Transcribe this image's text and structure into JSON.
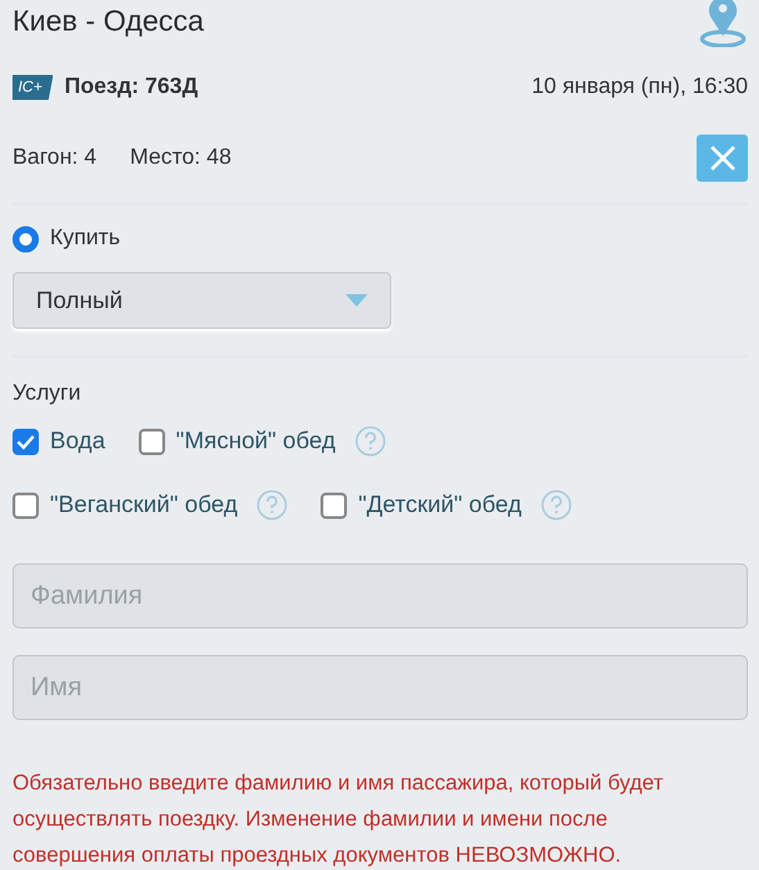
{
  "route": {
    "title": "Киев - Одесса"
  },
  "train": {
    "logo": "IC+",
    "label": "Поезд: 763Д",
    "datetime": "10 января (пн), 16:30"
  },
  "seat": {
    "wagon": "Вагон: 4",
    "place": "Место: 48"
  },
  "ticket_type": {
    "label": "Купить",
    "selected": true
  },
  "fare": {
    "value": "Полный"
  },
  "services": {
    "title": "Услуги",
    "items": [
      {
        "label": "Вода",
        "checked": true,
        "help": false
      },
      {
        "label": "\"Мясной\" обед",
        "checked": false,
        "help": true
      },
      {
        "label": "\"Веганский\" обед",
        "checked": false,
        "help": true
      },
      {
        "label": "\"Детский\" обед",
        "checked": false,
        "help": true
      }
    ]
  },
  "fields": [
    {
      "placeholder": "Фамилия"
    },
    {
      "placeholder": "Имя"
    }
  ],
  "warning": "Обязательно введите фамилию и имя пассажира, который будет осуществлять поездку. Изменение фамилии и имени после совершения оплаты проездных документов НЕВОЗМОЖНО."
}
